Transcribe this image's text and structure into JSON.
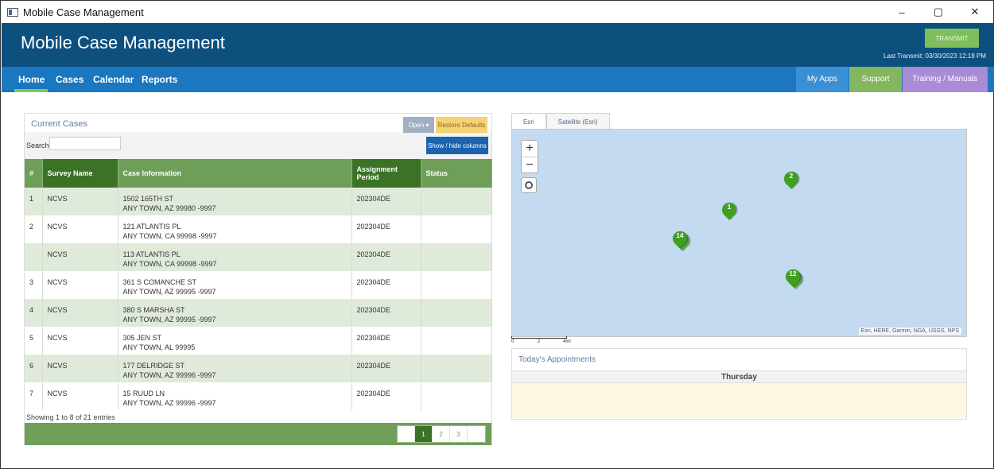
{
  "window": {
    "title": "Mobile Case Management",
    "controls": {
      "minimize": "–",
      "maximize": "▢",
      "close": "✕"
    }
  },
  "header": {
    "app_name": "Mobile Case Management",
    "transmit_label": "TRANSMIT",
    "last_transmit": "Last Transmit: 03/30/2023 12:18 PM"
  },
  "nav": {
    "items": [
      "Home",
      "Cases",
      "Calendar",
      "Reports"
    ],
    "active": "Home",
    "right_items": [
      {
        "label": "My Apps",
        "color": "#3a8fd6"
      },
      {
        "label": "Support",
        "color": "#84b65f"
      },
      {
        "label": "Training / Manuals",
        "color": "#a98bd6"
      }
    ]
  },
  "cases": {
    "title": "Current Cases",
    "open_label": "Open ▾",
    "restore_label": "Restore Defaults",
    "search_label": "Search",
    "search_value": "",
    "show_hide_label": "Show / hide columns",
    "columns": [
      "#",
      "Survey Name",
      "Case Information",
      "Assignment Period",
      "Status"
    ],
    "rows": [
      {
        "num": "1",
        "survey": "NCVS",
        "addr1": "1502 165TH ST",
        "addr2": "ANY TOWN, AZ 99980 -9997",
        "period": "202304DE",
        "status": ""
      },
      {
        "num": "2",
        "survey": "NCVS",
        "addr1": "121 ATLANTIS PL",
        "addr2": "ANY TOWN, CA 99998 -9997",
        "period": "202304DE",
        "status": ""
      },
      {
        "num": "",
        "survey": "NCVS",
        "addr1": "113 ATLANTIS PL",
        "addr2": "ANY TOWN, CA 99998 -9997",
        "period": "202304DE",
        "status": ""
      },
      {
        "num": "3",
        "survey": "NCVS",
        "addr1": "361 S COMANCHE ST",
        "addr2": "ANY TOWN, AZ 99995 -9997",
        "period": "202304DE",
        "status": ""
      },
      {
        "num": "4",
        "survey": "NCVS",
        "addr1": "380 S MARSHA ST",
        "addr2": "ANY TOWN, AZ 99995 -9997",
        "period": "202304DE",
        "status": ""
      },
      {
        "num": "5",
        "survey": "NCVS",
        "addr1": "305 JEN ST",
        "addr2": "ANY TOWN, AL 99995",
        "period": "202304DE",
        "status": ""
      },
      {
        "num": "6",
        "survey": "NCVS",
        "addr1": "177 DELRIDGE ST",
        "addr2": "ANY TOWN, AZ 99996 -9997",
        "period": "202304DE",
        "status": ""
      },
      {
        "num": "7",
        "survey": "NCVS",
        "addr1": "15 RUUD LN",
        "addr2": "ANY TOWN, AZ 99996 -9997",
        "period": "202304DE",
        "status": ""
      }
    ],
    "footer": "Showing 1 to 8 of 21 entries",
    "pages": [
      "",
      "1",
      "2",
      "3",
      ""
    ],
    "active_page": "1"
  },
  "map": {
    "tabs": [
      "Esri",
      "Satellite (Esri)"
    ],
    "active_tab": "Esri",
    "zoom_in": "+",
    "zoom_out": "−",
    "markers": [
      "2",
      "1",
      "14",
      "12"
    ],
    "attribution": "Esri, HERE, Garmin, NGA, USGS, NPS",
    "scale": [
      "0",
      "2",
      "4mi"
    ]
  },
  "appointments": {
    "title": "Today's Appointments",
    "day": "Thursday"
  }
}
